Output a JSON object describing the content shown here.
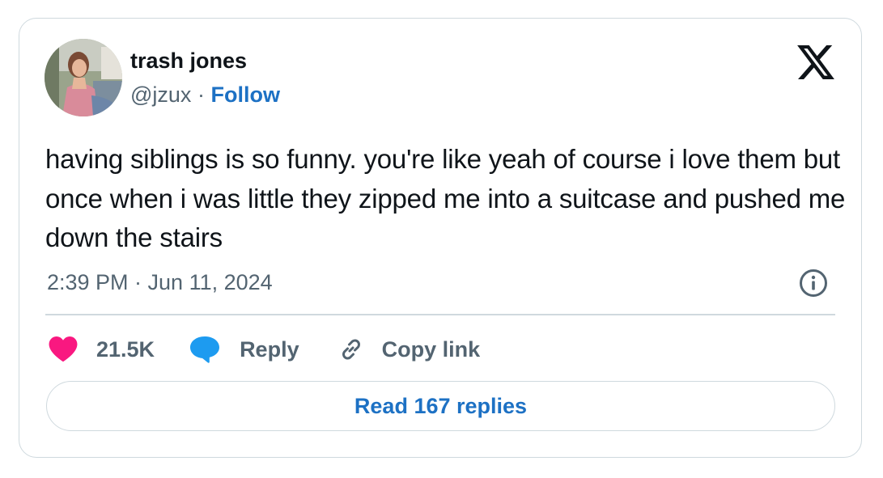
{
  "author": {
    "name": "trash jones",
    "handle": "@jzux",
    "separator": "·",
    "follow_label": "Follow"
  },
  "tweet": {
    "text": "having siblings is so funny. you're like yeah of course i love them but once when i was little they zipped me into a suitcase and pushed me down the stairs",
    "timestamp": "2:39 PM · Jun 11, 2024"
  },
  "actions": {
    "likes_count": "21.5K",
    "reply_label": "Reply",
    "copy_link_label": "Copy link"
  },
  "read_replies_label": "Read 167 replies",
  "icons": {
    "brand": "x-logo-icon",
    "info": "info-icon",
    "like": "heart-icon",
    "reply": "speech-bubble-icon",
    "copy": "link-icon"
  },
  "colors": {
    "link_blue": "#1d71c4",
    "heart_pink": "#f91880",
    "reply_blue": "#1d9bf0",
    "secondary_text": "#536471",
    "border": "#cfd9de"
  }
}
